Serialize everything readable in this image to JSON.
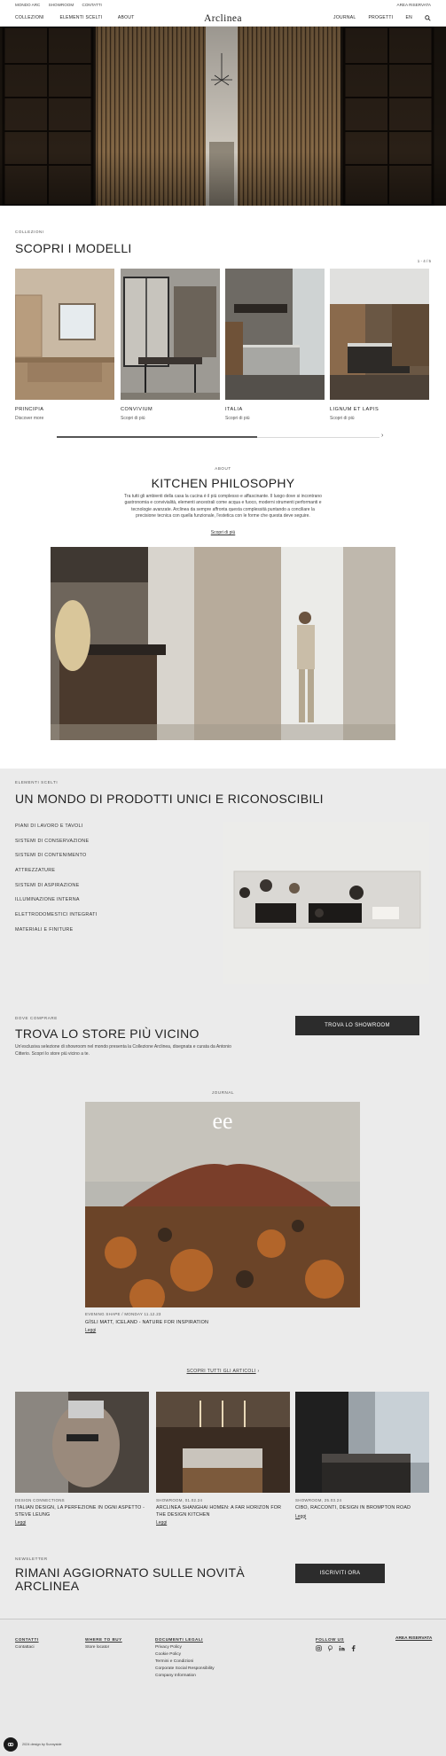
{
  "topbar": {
    "links": [
      "MONDO ARC",
      "SHOWROOM",
      "CONTATTI"
    ],
    "right": "AREA RISERVATA"
  },
  "nav": {
    "left": [
      "COLLEZIONI",
      "ELEMENTI SCELTI",
      "ABOUT"
    ],
    "logo": "Arclinea",
    "right": [
      "JOURNAL",
      "PROGETTI",
      "EN"
    ],
    "search_icon": "search-icon"
  },
  "models": {
    "kicker": "COLLEZIONI",
    "title": "SCOPRI I MODELLI",
    "counter": "1 - 4 / 5",
    "next": "›",
    "items": [
      {
        "name": "PRINCIPIA",
        "link": "Discover more"
      },
      {
        "name": "CONVIVIUM",
        "link": "Scopri di più"
      },
      {
        "name": "ITALIA",
        "link": "Scopri di più"
      },
      {
        "name": "LIGNUM ET LAPIS",
        "link": "Scopri di più"
      }
    ]
  },
  "philosophy": {
    "kicker": "ABOUT",
    "title": "KITCHEN PHILOSOPHY",
    "lines": [
      "Tra tutti gli ambienti della casa la cucina è il più complesso e affascinante. Il luogo dove si incontrano",
      "gastronomia e convivialità, elementi ancestrali come acqua e fuoco, moderni strumenti performanti e",
      "tecnologie avanzate. Arclinea da sempre affronta questa complessità puntando a conciliare la",
      "precisione tecnica con quella funzionale, l'estetica con le forme che questa deve seguire."
    ],
    "link": "Scopri di più"
  },
  "products": {
    "kicker": "ELEMENTI SCELTI",
    "title": "UN MONDO DI PRODOTTI UNICI E RICONOSCIBILI",
    "list": [
      "PIANI DI LAVORO E TAVOLI",
      "SISTEMI DI CONSERVAZIONE",
      "SISTEMI DI CONTENIMENTO",
      "ATTREZZATURE",
      "SISTEMI DI ASPIRAZIONE",
      "ILLUMINAZIONE INTERNA",
      "ELETTRODOMESTICI INTEGRATI",
      "MATERIALI E FINITURE"
    ]
  },
  "store": {
    "kicker": "DOVE COMPRARE",
    "title": "TROVA LO STORE PIÙ VICINO",
    "text": [
      "Un'esclusiva selezione di showroom nel mondo presenta la Collezione Arclinea, disegnata e curata da Antonio",
      "Citterio. Scopri lo store più vicino a te."
    ],
    "button": "TROVA LO SHOWROOM"
  },
  "journal": {
    "kicker": "JOURNAL",
    "featured": {
      "meta": "EVENING SHAPE / MONDAY 11.12.23",
      "title": "GÍSLI MATT, ICELAND - NATURE FOR INSPIRATION",
      "read": "Leggi"
    },
    "all_link": "SCOPRI TUTTI GLI ARTICOLI",
    "articles": [
      {
        "meta": "DESIGN CONNECTIONS",
        "title": "ITALIAN DESIGN, LA PERFEZIONE IN OGNI ASPETTO - STEVE LEUNG",
        "read": "Leggi"
      },
      {
        "meta": "SHOWROOM, 01.02.24",
        "title": "ARCLINEA SHANGHAI HOMEN: A FAR HORIZON FOR THE DESIGN KITCHEN",
        "read": "Leggi"
      },
      {
        "meta": "SHOWROOM, 25.03.24",
        "title": "CIBO, RACCONTI, DESIGN IN BROMPTON ROAD",
        "read": "Leggi"
      }
    ]
  },
  "newsletter": {
    "kicker": "NEWSLETTER",
    "title": [
      "RIMANI AGGIORNATO SULLE NOVITÀ",
      "ARCLINEA"
    ],
    "button": "ISCRIVITI ORA"
  },
  "footer": {
    "cols": [
      {
        "hd": "CONTATTI",
        "items": [
          "Contattaci"
        ]
      },
      {
        "hd": "WHERE TO BUY",
        "items": [
          "Store locator"
        ]
      },
      {
        "hd": "DOCUMENTI LEGALI",
        "items": [
          "Privacy Policy",
          "Cookie Policy",
          "Termini e Condizioni",
          "Corporate Social Responsibility",
          "Company Information"
        ]
      },
      {
        "hd": "FOLLOW US",
        "items": []
      }
    ],
    "reserved": "AREA RISERVATA",
    "social": [
      "instagram-icon",
      "pinterest-icon",
      "linkedin-icon",
      "facebook-icon"
    ],
    "credit": "2024 design by Sunnyside"
  },
  "colors": {
    "accent": "#2c2c2c",
    "grey_bg": "#ebebeb",
    "footer_bg": "#e8e8e8"
  }
}
